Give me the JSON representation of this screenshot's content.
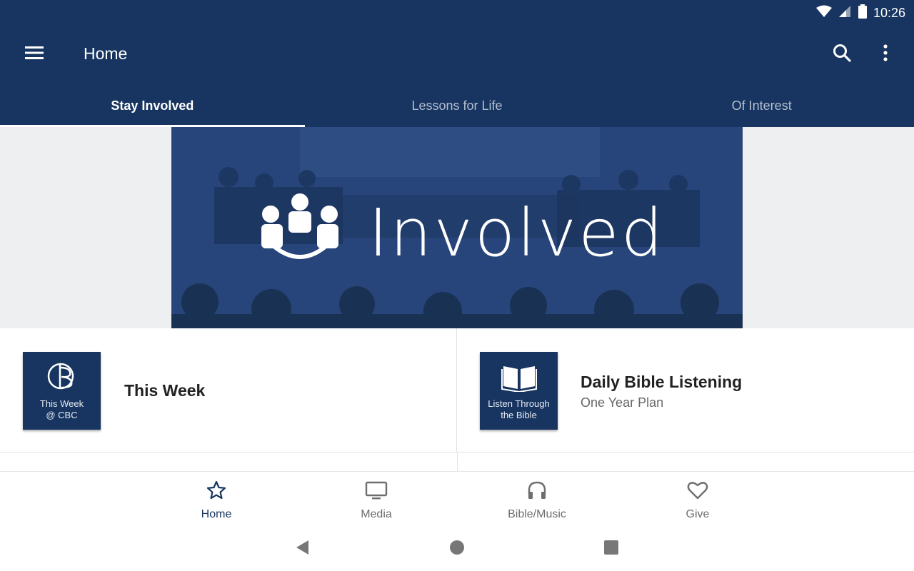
{
  "status_bar": {
    "time": "10:26"
  },
  "app_bar": {
    "title": "Home"
  },
  "tabs": [
    {
      "label": "Stay Involved",
      "active": true
    },
    {
      "label": "Lessons for Life",
      "active": false
    },
    {
      "label": "Of Interest",
      "active": false
    }
  ],
  "hero": {
    "text": "Involved"
  },
  "cards": [
    {
      "title": "This Week",
      "subtitle": "",
      "thumb_text": "This Week\n@ CBC"
    },
    {
      "title": "Daily Bible Listening",
      "subtitle": "One Year Plan",
      "thumb_text": "Listen Through\nthe Bible"
    }
  ],
  "bottom_nav": [
    {
      "label": "Home",
      "icon": "star-icon",
      "active": true
    },
    {
      "label": "Media",
      "icon": "tv-icon",
      "active": false
    },
    {
      "label": "Bible/Music",
      "icon": "headphones-icon",
      "active": false
    },
    {
      "label": "Give",
      "icon": "heart-icon",
      "active": false
    }
  ],
  "colors": {
    "primary": "#173560",
    "background": "#edeff1",
    "active_nav": "#173560"
  }
}
